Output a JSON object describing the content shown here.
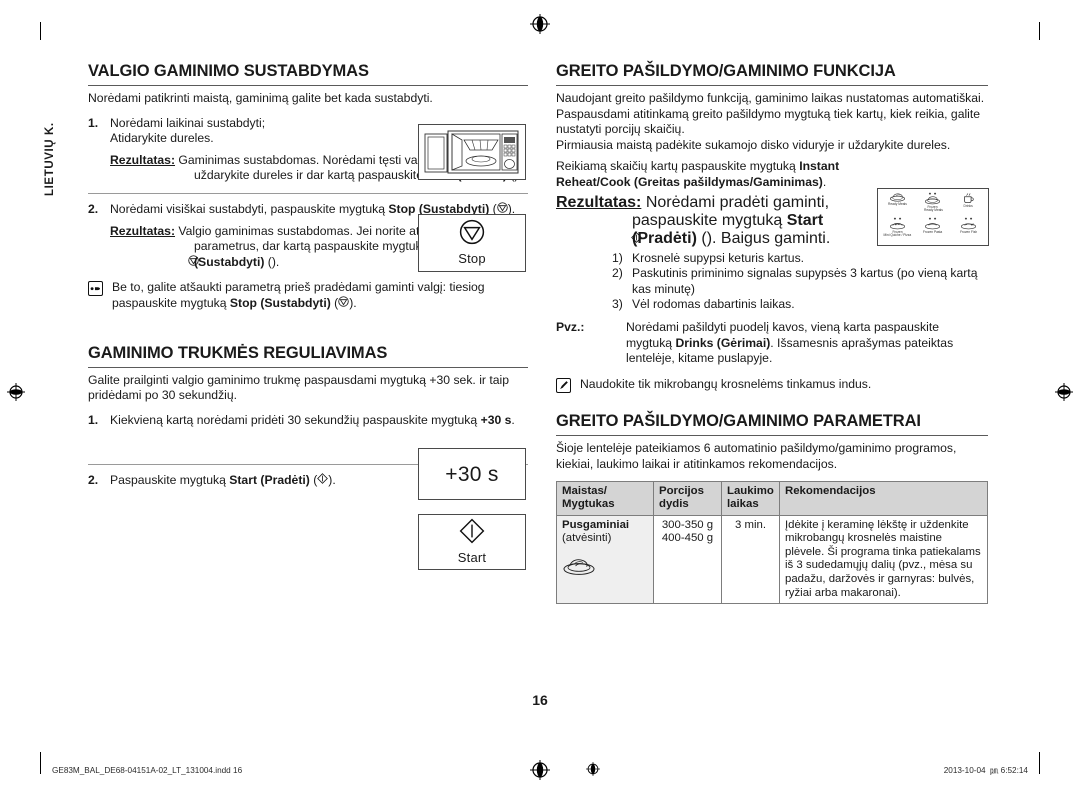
{
  "sidebar": {
    "language_tab": "LIETUVIŲ K."
  },
  "page_number": "16",
  "footer": {
    "file_name": "GE83M_BAL_DE68-04151A-02_LT_131004.indd   16",
    "date": "2013-10-04",
    "time": "6:52:14",
    "ampm_mark": "㏘"
  },
  "left_column": {
    "section1": {
      "heading": "VALGIO GAMINIMO SUSTABDYMAS",
      "intro": "Norėdami patikrinti maistą, gaminimą galite bet kada sustabdyti.",
      "step1": {
        "num": "1.",
        "line1": "Norėdami laikinai sustabdyti;",
        "line2": "Atidarykite dureles.",
        "result_label": "Rezultatas:",
        "result_text_1": "Gaminimas sustabdomas. Norėdami tęsti valgio gaminimą, uždarykite dureles ir dar kartą paspauskite ",
        "result_bold": "Start (Pradėti)",
        "result_text_2": " (",
        "result_text_3": ")."
      },
      "step2": {
        "num": "2.",
        "text_1": "Norėdami visiškai sustabdyti, paspauskite mygtuką ",
        "bold_1": "Stop (Sustabdyti)",
        "text_2": " (",
        "text_3": ").",
        "result_label": "Rezultatas:",
        "result_text_1": "Valgio gaminimas sustabdomas. Jei norite atšaukti gaminimo parametrus, dar kartą paspauskite mygtuką ",
        "result_bold_1": "Stop (Sustabdyti)",
        "result_text_2": " (",
        "result_text_3": ")."
      },
      "note": {
        "icon": "pointing-hand-icon",
        "text_1": "Be to, galite atšaukti parametrą prieš pradėdami gaminti valgį: tiesiog paspauskite mygtuką ",
        "bold_1": "Stop (Sustabdyti)",
        "text_2": " (",
        "text_3": ")."
      },
      "microwave_image_alt": "microwave-open-door"
    },
    "section2": {
      "heading": "GAMINIMO TRUKMĖS REGULIAVIMAS",
      "intro": "Galite prailginti valgio gaminimo trukmę paspausdami mygtuką +30 sek. ir taip pridėdami po 30 sekundžių.",
      "step1": {
        "num": "1.",
        "text_1": "Kiekvieną kartą norėdami pridėti 30 sekundžių paspauskite mygtuką ",
        "bold_1": "+30 s",
        "text_2": "."
      },
      "step2": {
        "num": "2.",
        "text_1": "Paspauskite mygtuką ",
        "bold_1": "Start (Pradėti)",
        "text_2": " (",
        "text_3": ")."
      },
      "button_plus30": "+30 s",
      "button_start": "Start"
    },
    "button_stop": "Stop"
  },
  "right_column": {
    "section1": {
      "heading": "GREITO PAŠILDYMO/GAMINIMO FUNKCIJA",
      "para1": "Naudojant greito pašildymo funkciją, gaminimo laikas nustatomas automatiškai.",
      "para2": "Paspausdami atitinkamą greito pašildymo mygtuką tiek kartų, kiek reikia, galite nustatyti porcijų skaičių.",
      "para3": "Pirmiausia maistą padėkite sukamojo disko viduryje ir uždarykite dureles.",
      "para4_text_1": "Reikiamą skaičių kartų paspauskite mygtuką ",
      "para4_bold": "Instant Reheat/Cook (Greitas pašildymas/Gaminimas)",
      "para4_text_2": ".",
      "result_label": "Rezultatas:",
      "result_text_1": "Norėdami pradėti gaminti, paspauskite mygtuką ",
      "result_bold": "Start (Pradėti)",
      "result_text_2": " (",
      "result_text_3": "). Baigus gaminti.",
      "sub_items": [
        {
          "marker": "1)",
          "text": "Krosnelė supypsi keturis kartus."
        },
        {
          "marker": "2)",
          "text": "Paskutinis priminimo signalas supypsės 3 kartus (po vieną kartą kas minutę)"
        },
        {
          "marker": "3)",
          "text": "Vėl rodomas dabartinis laikas."
        }
      ],
      "example": {
        "label": "Pvz.:",
        "text_1": "Norėdami pašildyti puodelį kavos, vieną karta paspauskite mygtuką ",
        "bold_1": "Drinks (Gėrimai)",
        "text_2": ". Išsamesnis aprašymas pateiktas lentelėje, kitame puslapyje."
      },
      "note": {
        "icon": "note-pencil-icon",
        "text": "Naudokite tik mikrobangų krosnelėms tinkamus indus."
      },
      "presets": [
        {
          "icon": "ready-meals-icon",
          "label": "Ready Meals"
        },
        {
          "icon": "frozen-ready-meals-icon",
          "label_top": "Frozen",
          "label": "Ready Meals"
        },
        {
          "icon": "drinks-icon",
          "label": "Drinks"
        },
        {
          "icon": "frozen-quiche-pizza-icon",
          "label_top": "Frozen",
          "label": "Mini Quiche / Pizza"
        },
        {
          "icon": "frozen-pasta-icon",
          "label": "Frozen Pasta"
        },
        {
          "icon": "frozen-fish-icon",
          "label": "Frozen Fish"
        }
      ]
    },
    "section2": {
      "heading": "GREITO PAŠILDYMO/GAMINIMO PARAMETRAI",
      "intro": "Šioje lentelėje pateikiamos 6 automatinio pašildymo/gaminimo programos, kiekiai, laukimo laikai ir atitinkamos rekomendacijos.",
      "table": {
        "headers": [
          "Maistas/ Mygtukas",
          "Porcijos dydis",
          "Laukimo laikas",
          "Rekomendacijos"
        ],
        "header_lines": [
          [
            "Maistas/",
            "Mygtukas"
          ],
          [
            "Porcijos",
            "dydis"
          ],
          [
            "Laukimo",
            "laikas"
          ],
          [
            "Rekomendacijos"
          ]
        ],
        "rows": [
          {
            "food_name": "Pusgaminiai",
            "food_sub": "(atvėsinti)",
            "food_icon": "ready-meal-plate-icon",
            "portion_lines": [
              "300-350 g",
              "400-450 g"
            ],
            "standing_time": "3 min.",
            "recommendation": "Įdėkite į keraminę lėkštę ir uždenkite mikrobangų krosnelės maistine plėvele. Ši programa tinka patiekalams iš 3 sudedamųjų dalių (pvz., mėsa su padažu, daržovės ir garnyras: bulvės, ryžiai arba makaronai)."
          }
        ]
      }
    }
  }
}
